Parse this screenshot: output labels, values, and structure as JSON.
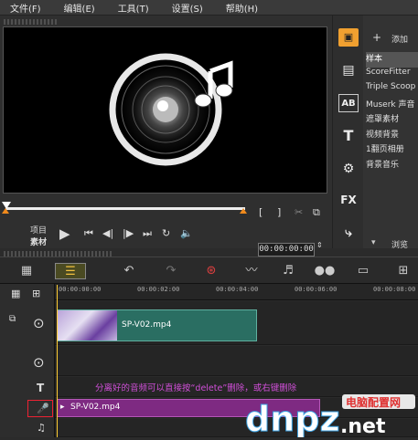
{
  "menu": {
    "file": "文件(F)",
    "edit": "编辑(E)",
    "tools": "工具(T)",
    "settings": "设置(S)",
    "help": "帮助(H)"
  },
  "player": {
    "mode_project": "项目",
    "mode_clip": "素材",
    "timecode": "00:00:00:00"
  },
  "library": {
    "add_label": "添加",
    "browse_label": "浏览",
    "items": [
      "样本",
      "ScoreFitter",
      "Triple Scoop",
      "Muserk 声音",
      "遮罩素材",
      "视频背景",
      "1翻页相册",
      "背景音乐"
    ],
    "selected_index": 0,
    "icons": [
      "media-icon",
      "instant-project-icon",
      "title-ab-icon",
      "text-t-icon",
      "transition-icon",
      "fx-icon",
      "path-icon"
    ]
  },
  "timeline": {
    "ruler_ticks": [
      "00:00:00:00",
      "00:00:02:00",
      "00:00:04:00",
      "00:00:06:00",
      "00:00:08:00"
    ],
    "video_clip_label": "SP-V02.mp4",
    "audio_clip_label": "SP-V02.mp4",
    "hint_text": "分离好的音频可以直接按“delete”删除，或右键删除",
    "title_track_label": "T"
  },
  "watermark": {
    "brand": "dnpz.net",
    "site_cn": "电脑配置网"
  },
  "colors": {
    "accent_orange": "#f08a1c",
    "video_clip": "#2a6e62",
    "audio_clip": "#7e2a82",
    "hint": "#d04fd8",
    "highlight": "#e22233"
  }
}
